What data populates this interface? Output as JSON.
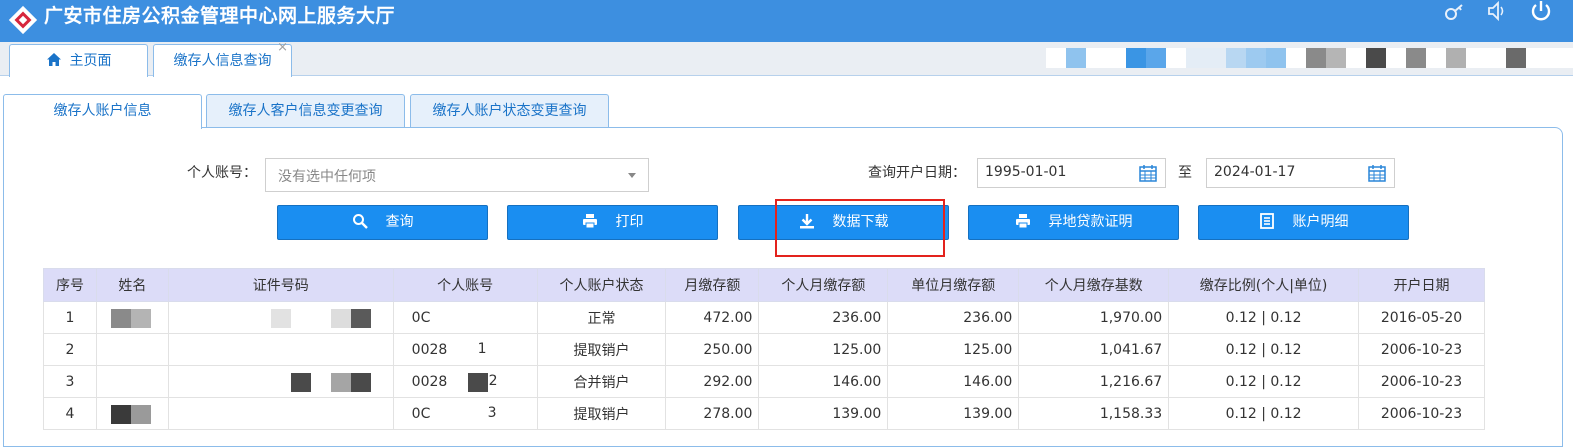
{
  "app": {
    "title": "广安市住房公积金管理中心网上服务大厅"
  },
  "topbar_icons": [
    "key-icon",
    "speaker-icon",
    "power-icon"
  ],
  "main_tabs": [
    {
      "label": "主页面",
      "icon": "home-icon"
    },
    {
      "label": "缴存人信息查询",
      "close": "×"
    }
  ],
  "sub_tabs": [
    {
      "label": "缴存人账户信息",
      "active": true
    },
    {
      "label": "缴存人客户信息变更查询"
    },
    {
      "label": "缴存人账户状态变更查询"
    }
  ],
  "form": {
    "account_label": "个人账号：",
    "account_placeholder": "没有选中任何项",
    "date_label": "查询开户日期：",
    "date_from": "1995-01-01",
    "date_sep": "至",
    "date_to": "2024-01-17"
  },
  "buttons": [
    {
      "label": "查询",
      "icon": "search-icon"
    },
    {
      "label": "打印",
      "icon": "printer-icon"
    },
    {
      "label": "数据下载",
      "icon": "download-icon"
    },
    {
      "label": "异地贷款证明",
      "icon": "printer-icon"
    },
    {
      "label": "账户明细",
      "icon": "list-icon"
    }
  ],
  "table": {
    "headers": [
      "序号",
      "姓名",
      "证件号码",
      "个人账号",
      "个人账户状态",
      "月缴存额",
      "个人月缴存额",
      "单位月缴存额",
      "个人月缴存基数",
      "缴存比例(个人|单位)",
      "开户日期"
    ],
    "rows": [
      [
        "1",
        "",
        "",
        "0C",
        "正常",
        "472.00",
        "236.00",
        "236.00",
        "1,970.00",
        "0.12 | 0.12",
        "2016-05-20"
      ],
      [
        "2",
        "",
        "",
        "0028",
        "提取销户",
        "250.00",
        "125.00",
        "125.00",
        "1,041.67",
        "0.12 | 0.12",
        "2006-10-23"
      ],
      [
        "3",
        "",
        "",
        "0028",
        "合并销户",
        "292.00",
        "146.00",
        "146.00",
        "1,216.67",
        "0.12 | 0.12",
        "2006-10-23"
      ],
      [
        "4",
        "",
        "",
        "0C",
        "提取销户",
        "278.00",
        "139.00",
        "139.00",
        "1,158.33",
        "0.12 | 0.12",
        "2006-10-23"
      ]
    ],
    "account_suffixes": [
      "",
      "1",
      "2",
      "3"
    ]
  },
  "colors": {
    "header_blue": "#3d8fe0",
    "button_blue": "#1a8ef1",
    "highlight_red": "#e3231d",
    "table_header": "#dcdcf8"
  }
}
